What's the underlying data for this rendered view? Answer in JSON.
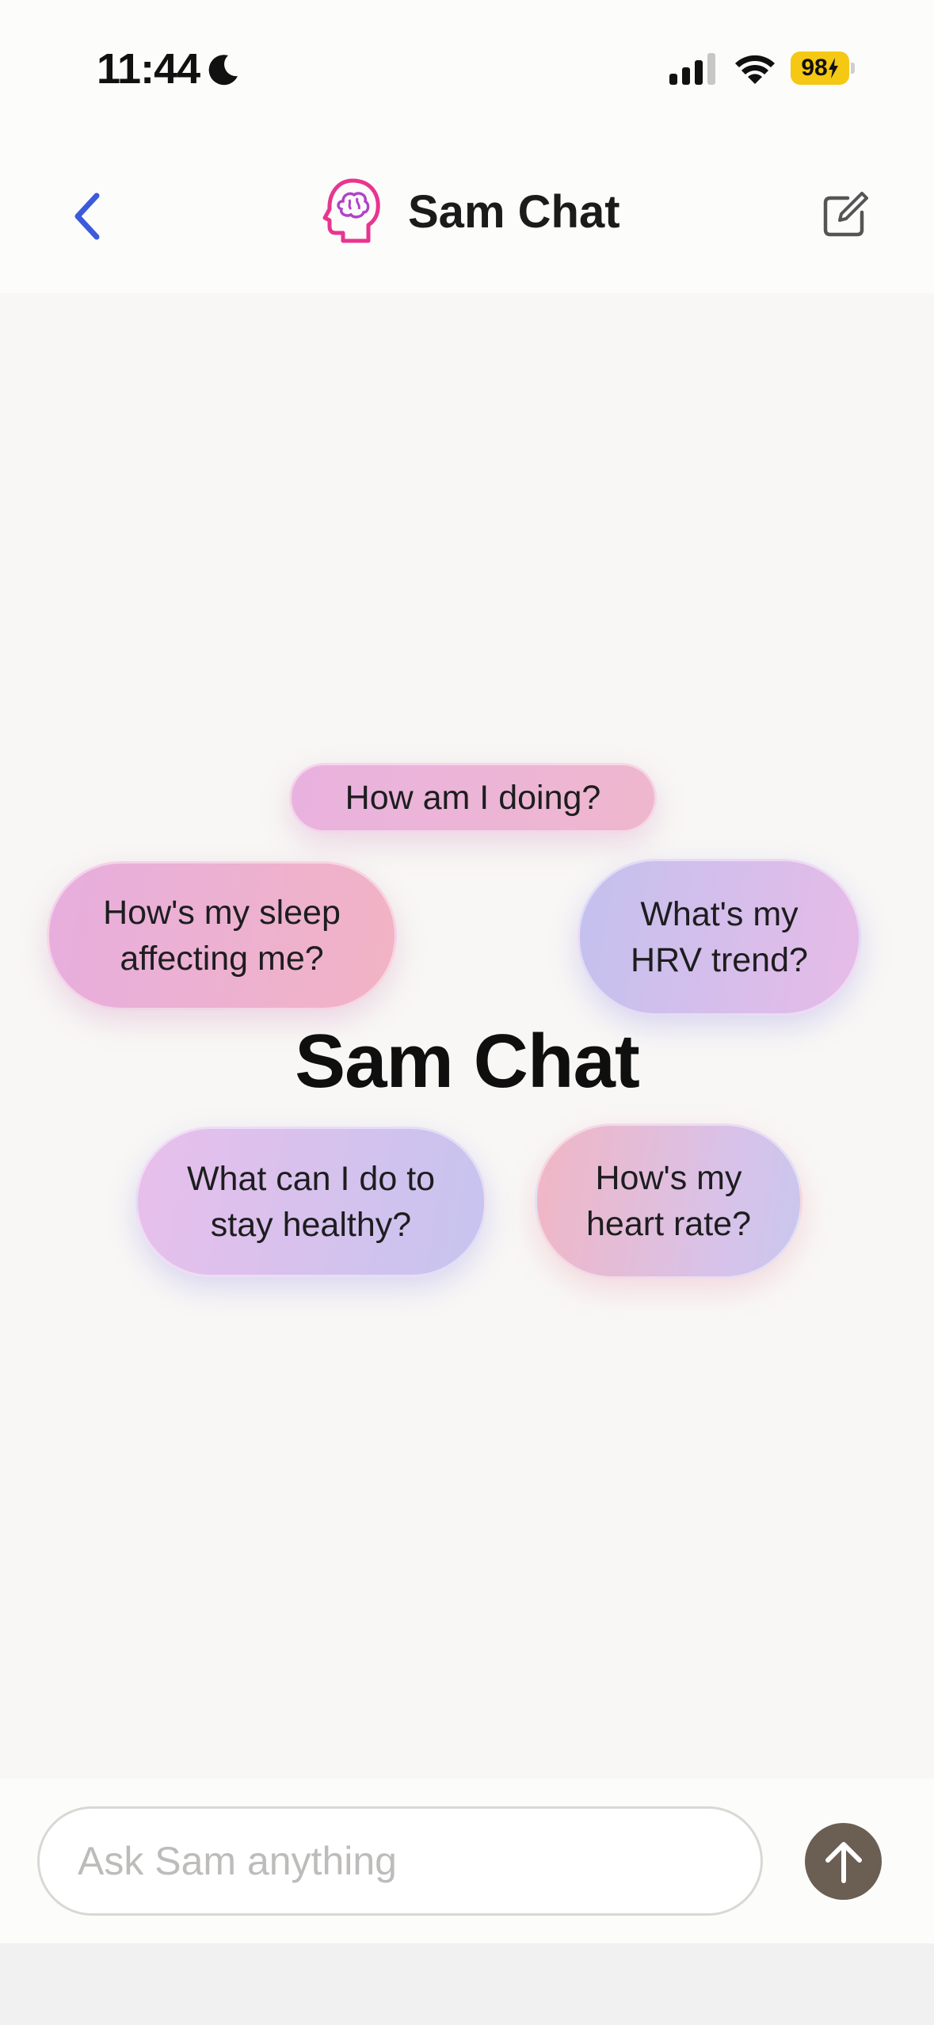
{
  "status_bar": {
    "time": "11:44",
    "battery": "98",
    "icons": [
      "moon-icon",
      "signal-icon",
      "wifi-icon",
      "battery-icon"
    ]
  },
  "nav": {
    "title": "Sam Chat",
    "back_icon": "chevron-left-icon",
    "logo_icon": "brain-head-icon",
    "compose_icon": "compose-icon"
  },
  "main": {
    "hero_title": "Sam Chat",
    "suggestions": [
      {
        "id": "how-am-i-doing",
        "line1": "How am I doing?",
        "line2": ""
      },
      {
        "id": "sleep",
        "line1": "How's my sleep",
        "line2": "affecting me?"
      },
      {
        "id": "hrv",
        "line1": "What's my",
        "line2": "HRV trend?"
      },
      {
        "id": "healthy",
        "line1": "What can I do to",
        "line2": "stay healthy?"
      },
      {
        "id": "heart-rate",
        "line1": "How's my",
        "line2": "heart rate?"
      }
    ]
  },
  "input": {
    "placeholder": "Ask Sam anything",
    "value": "",
    "send_icon": "arrow-up-icon"
  },
  "colors": {
    "accent_blue": "#3b5bdb",
    "logo_pink": "#e8358f",
    "battery_yellow": "#f5c813",
    "send_button": "#6b5e53"
  }
}
